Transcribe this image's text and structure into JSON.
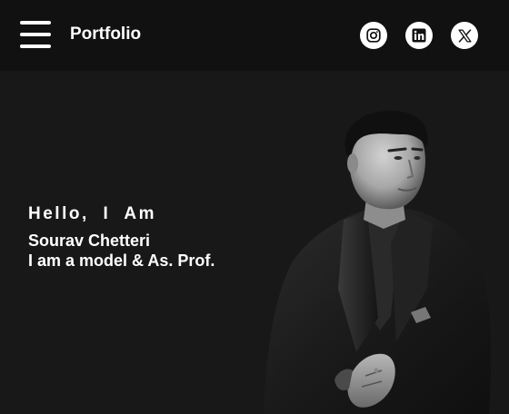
{
  "header": {
    "brand": "Portfolio",
    "menu_icon": "hamburger-menu-icon",
    "social": [
      {
        "name": "instagram",
        "icon": "instagram-icon"
      },
      {
        "name": "linkedin",
        "icon": "linkedin-icon"
      },
      {
        "name": "x",
        "icon": "x-icon"
      }
    ]
  },
  "hero": {
    "greeting": "Hello, I Am",
    "name": "Sourav Chetteri",
    "role": "I am a model & As. Prof.",
    "portrait": "grayscale-portrait-photo"
  },
  "colors": {
    "header_bg": "#111111",
    "hero_bg": "#181818",
    "text": "#ffffff",
    "icon_circle": "#ffffff"
  }
}
